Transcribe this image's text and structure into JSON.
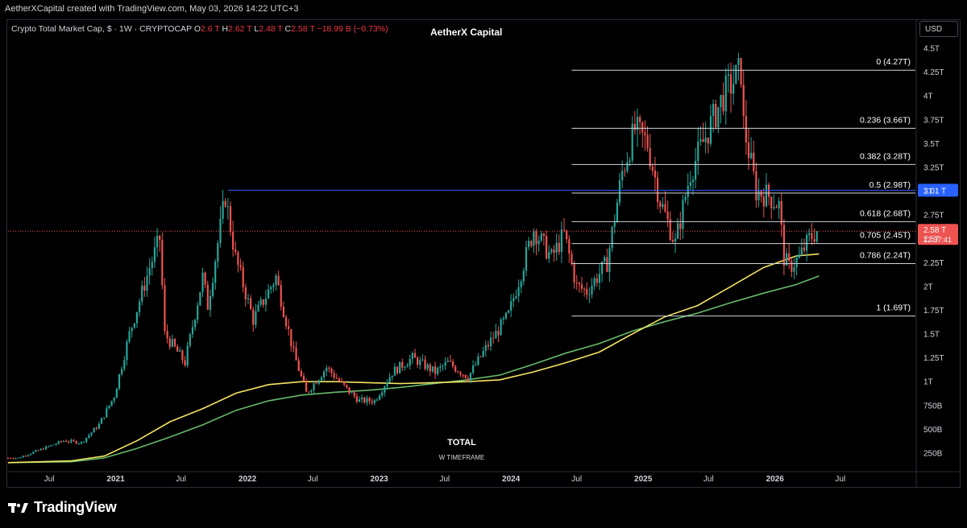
{
  "header": {
    "attribution": "AetherXCapital created with TradingView.com, May 03, 2026 14:22 UTC+3",
    "brand": "AetherX Capital",
    "currency": "USD"
  },
  "legend": {
    "symbol": "Crypto Total Market Cap, $ · 1W · CRYPTOCAP",
    "o_label": "O",
    "o_value": "2.6 T",
    "h_label": "H",
    "h_value": "2.62 T",
    "l_label": "L",
    "l_value": "2.48 T",
    "c_label": "C",
    "c_value": "2.58 T",
    "change": "−18.99 B (−0.73%)"
  },
  "footer": {
    "logo_text": "TradingView"
  },
  "colors": {
    "up": "#26a69a",
    "down": "#ef5350",
    "ema_yellow": "#f5e663",
    "ema_green": "#66bb6a",
    "fib_line": "#d1d4dc",
    "ath_line": "#2962ff",
    "price_line": "#ef5350"
  },
  "chart_data": {
    "type": "candlestick",
    "title": "TOTAL",
    "subtitle": "W TIMEFRAME",
    "y_axis": {
      "ticks": [
        0.25,
        0.5,
        0.75,
        1,
        1.25,
        1.5,
        1.75,
        2,
        2.25,
        2.5,
        2.75,
        3,
        3.25,
        3.5,
        3.75,
        4,
        4.25,
        4.5
      ],
      "tick_labels": [
        "250B",
        "500B",
        "750B",
        "1T",
        "1.25T",
        "1.5T",
        "1.75T",
        "2T",
        "2.25T",
        "2.5T",
        "2.75T",
        "3T",
        "3.25T",
        "3.5T",
        "3.75T",
        "4T",
        "4.25T",
        "4.5T"
      ],
      "unit": "USD"
    },
    "x_axis": {
      "ticks": [
        "2020-07-01",
        "2021-01-01",
        "2021-07-01",
        "2022-01-01",
        "2022-07-01",
        "2023-01-01",
        "2023-07-01",
        "2024-01-01",
        "2024-07-01",
        "2025-01-01",
        "2025-07-01",
        "2026-01-01",
        "2026-07-01"
      ],
      "tick_labels": [
        "Jul",
        "2021",
        "Jul",
        "2022",
        "Jul",
        "2023",
        "Jul",
        "2024",
        "Jul",
        "2025",
        "Jul",
        "2026",
        "Jul"
      ],
      "range": [
        "2020-03-09",
        "2027-01-25"
      ]
    },
    "fibonacci": [
      {
        "level": "0",
        "value": 4.27,
        "label": "0 (4.27T)"
      },
      {
        "level": "0.236",
        "value": 3.66,
        "label": "0.236 (3.66T)"
      },
      {
        "level": "0.382",
        "value": 3.28,
        "label": "0.382 (3.28T)"
      },
      {
        "level": "0.5",
        "value": 2.98,
        "label": "0.5 (2.98T)"
      },
      {
        "level": "0.618",
        "value": 2.68,
        "label": "0.618 (2.68T)"
      },
      {
        "level": "0.705",
        "value": 2.45,
        "label": "0.705 (2.45T)"
      },
      {
        "level": "0.786",
        "value": 2.24,
        "label": "0.786 (2.24T)"
      },
      {
        "level": "1",
        "value": 1.69,
        "label": "1 (1.69T)"
      }
    ],
    "fib_range": {
      "start": "2024-06-17",
      "end": "2026-05-03"
    },
    "horizontal_level": {
      "value": 3.01,
      "label": "3.01 T",
      "start": "2021-11-08"
    },
    "last_price": {
      "value": 2.58,
      "label": "2.58 T",
      "countdown": "12:37:41"
    },
    "ema_yellow": [
      [
        "2020-03-09",
        0.15
      ],
      [
        "2020-09-01",
        0.17
      ],
      [
        "2020-12-01",
        0.22
      ],
      [
        "2021-03-01",
        0.38
      ],
      [
        "2021-06-01",
        0.58
      ],
      [
        "2021-09-01",
        0.72
      ],
      [
        "2021-12-01",
        0.88
      ],
      [
        "2022-03-01",
        0.97
      ],
      [
        "2022-06-01",
        1.0
      ],
      [
        "2022-09-01",
        1.0
      ],
      [
        "2022-12-01",
        0.99
      ],
      [
        "2023-03-01",
        0.98
      ],
      [
        "2023-06-01",
        0.99
      ],
      [
        "2023-09-01",
        1.0
      ],
      [
        "2023-12-01",
        1.02
      ],
      [
        "2024-03-01",
        1.1
      ],
      [
        "2024-06-01",
        1.2
      ],
      [
        "2024-09-01",
        1.31
      ],
      [
        "2024-12-01",
        1.5
      ],
      [
        "2025-03-01",
        1.68
      ],
      [
        "2025-06-01",
        1.8
      ],
      [
        "2025-09-01",
        2.0
      ],
      [
        "2025-12-01",
        2.2
      ],
      [
        "2026-03-01",
        2.32
      ],
      [
        "2026-05-03",
        2.34
      ]
    ],
    "ema_green": [
      [
        "2020-03-09",
        0.15
      ],
      [
        "2020-09-01",
        0.16
      ],
      [
        "2020-12-01",
        0.2
      ],
      [
        "2021-03-01",
        0.3
      ],
      [
        "2021-06-01",
        0.42
      ],
      [
        "2021-09-01",
        0.55
      ],
      [
        "2021-12-01",
        0.7
      ],
      [
        "2022-03-01",
        0.8
      ],
      [
        "2022-06-01",
        0.86
      ],
      [
        "2022-09-01",
        0.89
      ],
      [
        "2022-12-01",
        0.91
      ],
      [
        "2023-03-01",
        0.94
      ],
      [
        "2023-06-01",
        0.98
      ],
      [
        "2023-09-01",
        1.02
      ],
      [
        "2023-12-01",
        1.07
      ],
      [
        "2024-03-01",
        1.18
      ],
      [
        "2024-06-01",
        1.3
      ],
      [
        "2024-09-01",
        1.4
      ],
      [
        "2024-12-01",
        1.53
      ],
      [
        "2025-03-01",
        1.63
      ],
      [
        "2025-06-01",
        1.72
      ],
      [
        "2025-09-01",
        1.83
      ],
      [
        "2025-12-01",
        1.93
      ],
      [
        "2026-03-01",
        2.02
      ],
      [
        "2026-05-03",
        2.11
      ]
    ],
    "price_path": [
      [
        "2020-03-09",
        0.2
      ],
      [
        "2020-04-13",
        0.2
      ],
      [
        "2020-06-01",
        0.27
      ],
      [
        "2020-08-17",
        0.38
      ],
      [
        "2020-10-05",
        0.36
      ],
      [
        "2020-11-23",
        0.55
      ],
      [
        "2021-01-04",
        0.85
      ],
      [
        "2021-02-15",
        1.5
      ],
      [
        "2021-04-12",
        2.2
      ],
      [
        "2021-05-10",
        2.5
      ],
      [
        "2021-05-24",
        1.5
      ],
      [
        "2021-07-19",
        1.2
      ],
      [
        "2021-09-06",
        2.1
      ],
      [
        "2021-09-20",
        1.8
      ],
      [
        "2021-11-08",
        2.95
      ],
      [
        "2021-12-06",
        2.3
      ],
      [
        "2022-01-24",
        1.65
      ],
      [
        "2022-03-28",
        2.1
      ],
      [
        "2022-05-16",
        1.3
      ],
      [
        "2022-06-20",
        0.88
      ],
      [
        "2022-08-15",
        1.15
      ],
      [
        "2022-10-10",
        0.92
      ],
      [
        "2022-11-14",
        0.8
      ],
      [
        "2022-12-26",
        0.8
      ],
      [
        "2023-02-13",
        1.1
      ],
      [
        "2023-04-10",
        1.25
      ],
      [
        "2023-06-12",
        1.1
      ],
      [
        "2023-07-17",
        1.2
      ],
      [
        "2023-09-11",
        1.05
      ],
      [
        "2023-10-30",
        1.35
      ],
      [
        "2024-01-01",
        1.7
      ],
      [
        "2024-03-11",
        2.6
      ],
      [
        "2024-04-29",
        2.3
      ],
      [
        "2024-06-03",
        2.55
      ],
      [
        "2024-07-08",
        2.0
      ],
      [
        "2024-08-05",
        1.95
      ],
      [
        "2024-09-30",
        2.25
      ],
      [
        "2024-11-11",
        3.2
      ],
      [
        "2024-12-16",
        3.65
      ],
      [
        "2025-01-20",
        3.5
      ],
      [
        "2025-02-24",
        2.9
      ],
      [
        "2025-04-07",
        2.45
      ],
      [
        "2025-05-19",
        3.2
      ],
      [
        "2025-07-14",
        3.7
      ],
      [
        "2025-08-18",
        4.0
      ],
      [
        "2025-10-06",
        4.27
      ],
      [
        "2025-10-13",
        3.7
      ],
      [
        "2025-11-17",
        3.0
      ],
      [
        "2025-12-22",
        2.95
      ],
      [
        "2026-01-19",
        2.85
      ],
      [
        "2026-02-02",
        2.3
      ],
      [
        "2026-02-16",
        2.2
      ],
      [
        "2026-03-16",
        2.3
      ],
      [
        "2026-04-13",
        2.5
      ],
      [
        "2026-05-03",
        2.58
      ]
    ]
  }
}
